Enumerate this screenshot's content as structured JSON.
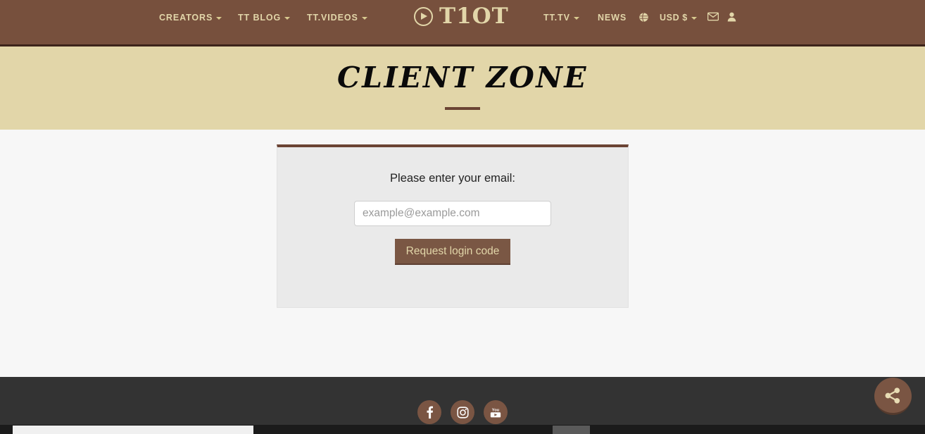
{
  "navbar": {
    "logo": {
      "icon": "play-circle-icon",
      "text": "T1OT"
    },
    "left_items": [
      {
        "label": "CREATORS",
        "has_caret": true
      },
      {
        "label": "TT BLOG",
        "has_caret": true
      },
      {
        "label": "TT.VIDEOS",
        "has_caret": true
      }
    ],
    "right_items": [
      {
        "label": "TT.TV",
        "has_caret": true
      },
      {
        "label": "NEWS",
        "has_caret": false
      }
    ],
    "language_icon": "globe-icon",
    "currency": {
      "label": "USD $",
      "has_caret": true
    },
    "mail_icon": "envelope-icon",
    "account_icon": "user-icon"
  },
  "banner": {
    "title": "CLIENT ZONE"
  },
  "form": {
    "label": "Please enter your email:",
    "email_placeholder": "example@example.com",
    "email_value": "",
    "submit_label": "Request login code"
  },
  "footer": {
    "social": [
      {
        "name": "facebook",
        "glyph": "f"
      },
      {
        "name": "instagram",
        "glyph": ""
      },
      {
        "name": "youtube",
        "glyph": ""
      }
    ],
    "share_icon": "share-icon"
  },
  "colors": {
    "nav_brown": "#77503d",
    "nav_border": "#3d241b",
    "banner_tan": "#e2d6a9",
    "accent_cream": "#e2d6a9",
    "card_bg": "#eaeaea",
    "card_top_border": "#6b4434",
    "button_brown": "#7a5744",
    "footer_dark": "#333333",
    "page_bg": "#f7f7f7"
  }
}
